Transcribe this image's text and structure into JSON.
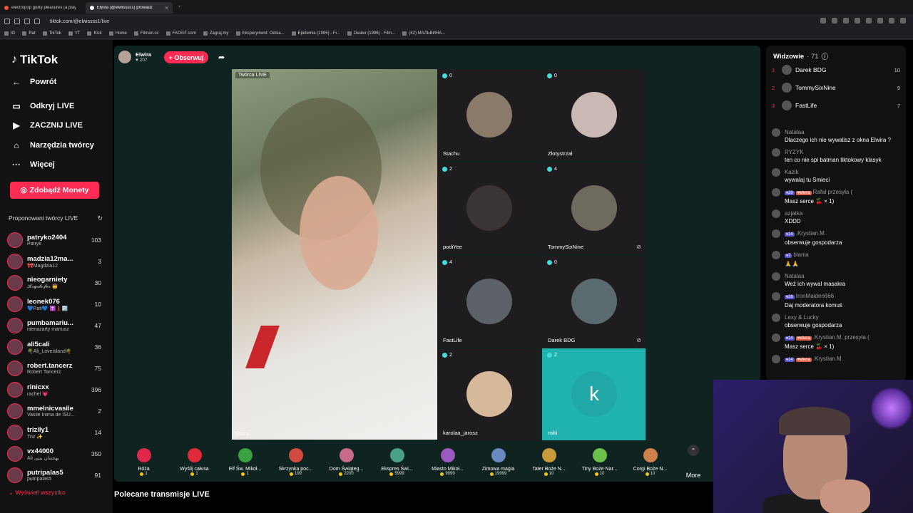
{
  "browser": {
    "tabs": [
      {
        "title": "electropop guilty pleasures (a playlis",
        "active": false
      },
      {
        "title": "Elwira (@elwissss1) prowadz",
        "active": true
      }
    ],
    "url": "tiktok.com/@elwissss1/live",
    "bookmarks": [
      "IG",
      "Rat",
      "TikTok",
      "YT",
      "Kick",
      "Home",
      "Filman.cc",
      "FACEIT.com",
      "Zagraj.my",
      "Eksperyment: Odsia...",
      "Epidemia (1995) - Fi...",
      "Dealer (1996) - Film...",
      "(42) МАЛЬВИНА..."
    ]
  },
  "sidebar": {
    "logo": "TikTok",
    "nav": [
      {
        "label": "Powrót",
        "icon": "back-arrow-icon"
      },
      {
        "label": "Odkryj LIVE",
        "icon": "monitor-icon"
      },
      {
        "label": "ZACZNIJ LIVE",
        "icon": "video-camera-icon"
      },
      {
        "label": "Narzędzia twórcy",
        "icon": "lightbulb-icon"
      },
      {
        "label": "Więcej",
        "icon": "more-dots-icon"
      }
    ],
    "coins_button": "Zdobądź Monety",
    "suggested_title": "Proponowani twórcy LIVE",
    "creators": [
      {
        "name": "patryko2404",
        "sub": "Patryk",
        "count": "103"
      },
      {
        "name": "madzia12ma...",
        "sub": "🎀Magdzia12",
        "count": "3"
      },
      {
        "name": "nieogarniety",
        "sub": "𝓚𝓻𝔂𝓼𝓽𝓸𝓯𝓮𝓻 🤠",
        "count": "30"
      },
      {
        "name": "leonek076",
        "sub": "💙Pati💙 ✝️🗼🅿️",
        "count": "10"
      },
      {
        "name": "pumbamariu...",
        "sub": "nienażarty mariusz",
        "count": "47"
      },
      {
        "name": "ali5cali",
        "sub": "🌴Ali_Loveisland🌴",
        "count": "36"
      },
      {
        "name": "robert.tancerz",
        "sub": "Robert Tancerz",
        "count": "75"
      },
      {
        "name": "rinicxx",
        "sub": "rachel 💗",
        "count": "396"
      },
      {
        "name": "mmelnicvasile",
        "sub": "Vasile Inima de ISU...",
        "count": "2"
      },
      {
        "name": "trizily1",
        "sub": "Triz ✨",
        "count": "14"
      },
      {
        "name": "vx44000",
        "sub": "Ali بهجتتان بنتى",
        "count": "350"
      },
      {
        "name": "putripalas5",
        "sub": "putripalas5",
        "count": "91"
      }
    ],
    "show_all": "Wyświetl wszystko"
  },
  "stream": {
    "host_name": "Elwira",
    "host_viewers": "207",
    "follow_button": "+ Obserwuj",
    "creator_tag": "Twórca LIVE",
    "main_name": "Elwira",
    "guests": [
      {
        "name": "Stachu",
        "count": "0",
        "muted": false,
        "color": "#8a7a6a"
      },
      {
        "name": "Złotystrzał",
        "count": "0",
        "muted": false,
        "color": "#c9b8b4"
      },
      {
        "name": "podiYee",
        "count": "2",
        "muted": false,
        "color": "#3a3434"
      },
      {
        "name": "TommySixNine",
        "count": "4",
        "muted": true,
        "color": "#6e6a5e"
      },
      {
        "name": "FastLife",
        "count": "4",
        "muted": false,
        "color": "#5c6268"
      },
      {
        "name": "Darek BDG",
        "count": "0",
        "muted": true,
        "color": "#5a6a6e"
      },
      {
        "name": "karolaa_jarosz",
        "count": "2",
        "muted": false,
        "color": "#d6b89a"
      },
      {
        "name": "miki",
        "count": "2",
        "muted": false,
        "color": "#21b3b0",
        "letter": "k"
      }
    ],
    "gifts": [
      {
        "name": "Róża",
        "price": "1",
        "color": "#e0264a"
      },
      {
        "name": "Wyślij całusa",
        "price": "1",
        "color": "#e02a3a"
      },
      {
        "name": "Elf Św. Mikoł...",
        "price": "1",
        "color": "#3aa040"
      },
      {
        "name": "Skrzynka poc...",
        "price": "199",
        "color": "#d04a40"
      },
      {
        "name": "Dom Świąteg...",
        "price": "2200",
        "color": "#c86a8a"
      },
      {
        "name": "Ekspres Świ...",
        "price": "5999",
        "color": "#4aa088"
      },
      {
        "name": "Miasto Mikoł...",
        "price": "9999",
        "color": "#9a5ac0"
      },
      {
        "name": "Zimowa magia",
        "price": "19999",
        "color": "#6a8ac0"
      },
      {
        "name": "Tater Boże N...",
        "price": "10",
        "color": "#c89a3a"
      },
      {
        "name": "Tiny Boże Nar...",
        "price": "10",
        "color": "#6ac04a"
      },
      {
        "name": "Corgi Boże N...",
        "price": "10",
        "color": "#d0804a"
      }
    ],
    "more": "More"
  },
  "recommended_title": "Polecane transmisje LIVE",
  "chat": {
    "viewers_title": "Widzowie",
    "viewers_count": "· 71",
    "top": [
      {
        "rank": "1",
        "name": "Darek BDG",
        "score": "10"
      },
      {
        "rank": "2",
        "name": "TommySixNine",
        "score": "9"
      },
      {
        "rank": "3",
        "name": "FastLife",
        "score": "7"
      }
    ],
    "messages": [
      {
        "user": "Natalaa",
        "text": "Dlaczego ich nie wywalisz z okna Elwira ?"
      },
      {
        "user": "RYZYK",
        "text": "ten co nie spi batman tiktokowy klasyk"
      },
      {
        "user": "Kazik",
        "text": "wywalaj tu Smieci"
      },
      {
        "user": "Rafał przesyła (",
        "text": "Masz serce 🍒 × 1)",
        "badge": "28",
        "badge2": "elwra"
      },
      {
        "user": "azjatka",
        "text": "XDDD"
      },
      {
        "user": ".Krystian.M.",
        "text": "obserwuje gospodarza",
        "badge": "14"
      },
      {
        "user": "blania",
        "text": "🙏🙏",
        "badge": "7"
      },
      {
        "user": "Natalaa",
        "text": "Weź ich wywal masakra"
      },
      {
        "user": "IronMaiden666",
        "text": "Daj moderatora komuś",
        "badge": "28"
      },
      {
        "user": "Lexy & Lucky",
        "text": "obserwuje gospodarza"
      },
      {
        "user": ".Krystian.M. przesyła (",
        "text": "Masz serce 🍒 × 1)",
        "badge": "14",
        "badge2": "elwra"
      },
      {
        "user": ".Krystian.M.",
        "text": "",
        "badge": "14",
        "badge2": "elwra"
      }
    ]
  }
}
